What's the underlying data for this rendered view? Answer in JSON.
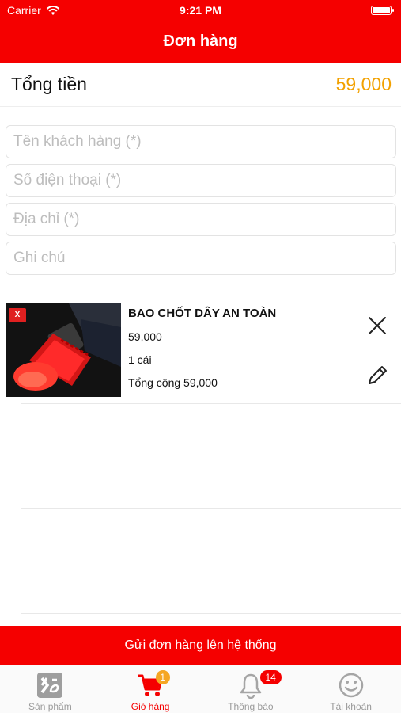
{
  "status_bar": {
    "carrier": "Carrier",
    "time": "9:21 PM"
  },
  "nav": {
    "title": "Đơn hàng"
  },
  "total": {
    "label": "Tổng tiền",
    "value": "59,000",
    "color": "#f2a100"
  },
  "form": {
    "customer_name_placeholder": "Tên khách hàng (*)",
    "phone_placeholder": "Số điện thoại (*)",
    "address_placeholder": "Địa chỉ (*)",
    "note_placeholder": "Ghi chú"
  },
  "cart_item": {
    "name": "BAO CHỐT DÂY AN TOÀN",
    "price": "59,000",
    "quantity": "1 cái",
    "subtotal": "Tổng cộng 59,000",
    "thumb_logo": "X",
    "remove_icon": "close-icon",
    "edit_icon": "pencil-icon"
  },
  "submit": {
    "label": "Gửi đơn hàng lên hệ thống"
  },
  "tabs": [
    {
      "label": "Sản phẩm",
      "icon": "app-logo-icon",
      "active": false
    },
    {
      "label": "Giỏ hàng",
      "icon": "cart-icon",
      "active": true,
      "badge": "1"
    },
    {
      "label": "Thông báo",
      "icon": "bell-icon",
      "active": false,
      "badge": "14"
    },
    {
      "label": "Tài khoản",
      "icon": "smiley-icon",
      "active": false
    }
  ],
  "colors": {
    "brand": "#f50000",
    "accent": "#f2a100",
    "badge_yellow": "#f5a623"
  }
}
